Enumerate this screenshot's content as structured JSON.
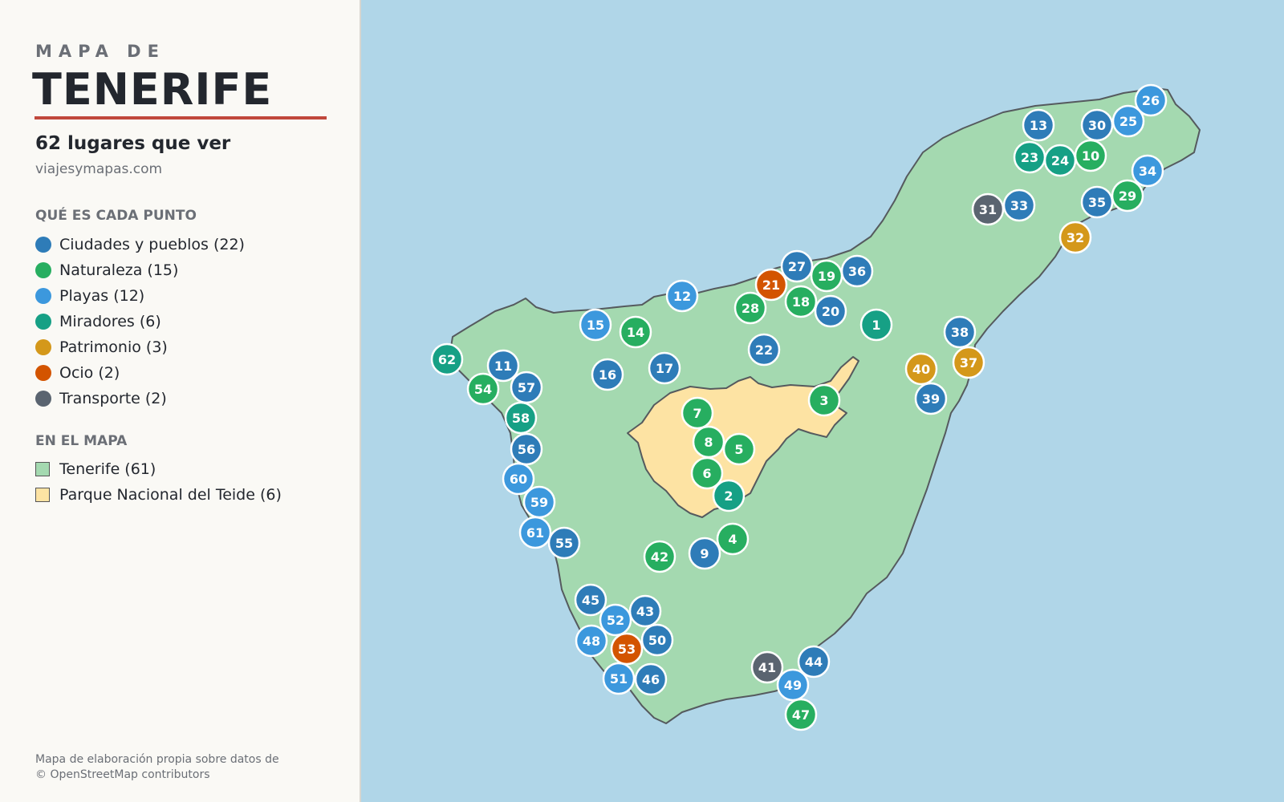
{
  "sidebar": {
    "kicker": "MAPA DE",
    "title": "TENERIFE",
    "subtitle": "62 lugares que ver",
    "site": "viajesymapas.com",
    "categories_heading": "QUÉ ES CADA PUNTO",
    "categories": [
      {
        "key": "ciudades",
        "label": "Ciudades y pueblos (22)",
        "color": "#2e7cb8"
      },
      {
        "key": "naturaleza",
        "label": "Naturaleza (15)",
        "color": "#27ae60"
      },
      {
        "key": "playas",
        "label": "Playas (12)",
        "color": "#3c98dd"
      },
      {
        "key": "miradores",
        "label": "Miradores (6)",
        "color": "#16a085"
      },
      {
        "key": "patrimonio",
        "label": "Patrimonio (3)",
        "color": "#d4981a"
      },
      {
        "key": "ocio",
        "label": "Ocio (2)",
        "color": "#d35400"
      },
      {
        "key": "transporte",
        "label": "Transporte (2)",
        "color": "#5a6470"
      }
    ],
    "map_heading": "EN EL MAPA",
    "map_layers": [
      {
        "key": "isla",
        "label": "Tenerife (61)",
        "color": "#a4d9b0"
      },
      {
        "key": "teide",
        "label": "Parque Nacional del Teide (6)",
        "color": "#fde3a3"
      }
    ],
    "attribution": [
      "Mapa de elaboración propia sobre datos de",
      "© OpenStreetMap contributors"
    ]
  },
  "map": {
    "sea_color": "#b0d6e8",
    "island_color": "#a4d9b0",
    "park_color": "#fde3a3",
    "points": [
      {
        "n": "1",
        "cat": "miradores"
      },
      {
        "n": "2",
        "cat": "miradores"
      },
      {
        "n": "3",
        "cat": "naturaleza"
      },
      {
        "n": "4",
        "cat": "naturaleza"
      },
      {
        "n": "5",
        "cat": "naturaleza"
      },
      {
        "n": "6",
        "cat": "naturaleza"
      },
      {
        "n": "7",
        "cat": "naturaleza"
      },
      {
        "n": "8",
        "cat": "naturaleza"
      },
      {
        "n": "9",
        "cat": "ciudades"
      },
      {
        "n": "10",
        "cat": "naturaleza"
      },
      {
        "n": "11",
        "cat": "ciudades"
      },
      {
        "n": "12",
        "cat": "playas"
      },
      {
        "n": "13",
        "cat": "ciudades"
      },
      {
        "n": "14",
        "cat": "naturaleza"
      },
      {
        "n": "15",
        "cat": "playas"
      },
      {
        "n": "16",
        "cat": "ciudades"
      },
      {
        "n": "17",
        "cat": "ciudades"
      },
      {
        "n": "18",
        "cat": "naturaleza"
      },
      {
        "n": "19",
        "cat": "naturaleza"
      },
      {
        "n": "20",
        "cat": "ciudades"
      },
      {
        "n": "21",
        "cat": "ocio"
      },
      {
        "n": "22",
        "cat": "ciudades"
      },
      {
        "n": "23",
        "cat": "miradores"
      },
      {
        "n": "24",
        "cat": "miradores"
      },
      {
        "n": "25",
        "cat": "playas"
      },
      {
        "n": "26",
        "cat": "playas"
      },
      {
        "n": "27",
        "cat": "ciudades"
      },
      {
        "n": "28",
        "cat": "naturaleza"
      },
      {
        "n": "29",
        "cat": "naturaleza"
      },
      {
        "n": "30",
        "cat": "ciudades"
      },
      {
        "n": "31",
        "cat": "transporte"
      },
      {
        "n": "32",
        "cat": "patrimonio"
      },
      {
        "n": "33",
        "cat": "ciudades"
      },
      {
        "n": "34",
        "cat": "playas"
      },
      {
        "n": "35",
        "cat": "ciudades"
      },
      {
        "n": "36",
        "cat": "ciudades"
      },
      {
        "n": "37",
        "cat": "patrimonio"
      },
      {
        "n": "38",
        "cat": "ciudades"
      },
      {
        "n": "39",
        "cat": "ciudades"
      },
      {
        "n": "40",
        "cat": "patrimonio"
      },
      {
        "n": "41",
        "cat": "transporte"
      },
      {
        "n": "42",
        "cat": "naturaleza"
      },
      {
        "n": "43",
        "cat": "ciudades"
      },
      {
        "n": "44",
        "cat": "ciudades"
      },
      {
        "n": "45",
        "cat": "ciudades"
      },
      {
        "n": "46",
        "cat": "ciudades"
      },
      {
        "n": "47",
        "cat": "naturaleza"
      },
      {
        "n": "48",
        "cat": "playas"
      },
      {
        "n": "49",
        "cat": "playas"
      },
      {
        "n": "50",
        "cat": "ciudades"
      },
      {
        "n": "51",
        "cat": "playas"
      },
      {
        "n": "52",
        "cat": "playas"
      },
      {
        "n": "53",
        "cat": "ocio"
      },
      {
        "n": "54",
        "cat": "naturaleza"
      },
      {
        "n": "55",
        "cat": "ciudades"
      },
      {
        "n": "56",
        "cat": "ciudades"
      },
      {
        "n": "57",
        "cat": "ciudades"
      },
      {
        "n": "58",
        "cat": "miradores"
      },
      {
        "n": "59",
        "cat": "playas"
      },
      {
        "n": "60",
        "cat": "playas"
      },
      {
        "n": "61",
        "cat": "playas"
      },
      {
        "n": "62",
        "cat": "miradores"
      }
    ]
  }
}
